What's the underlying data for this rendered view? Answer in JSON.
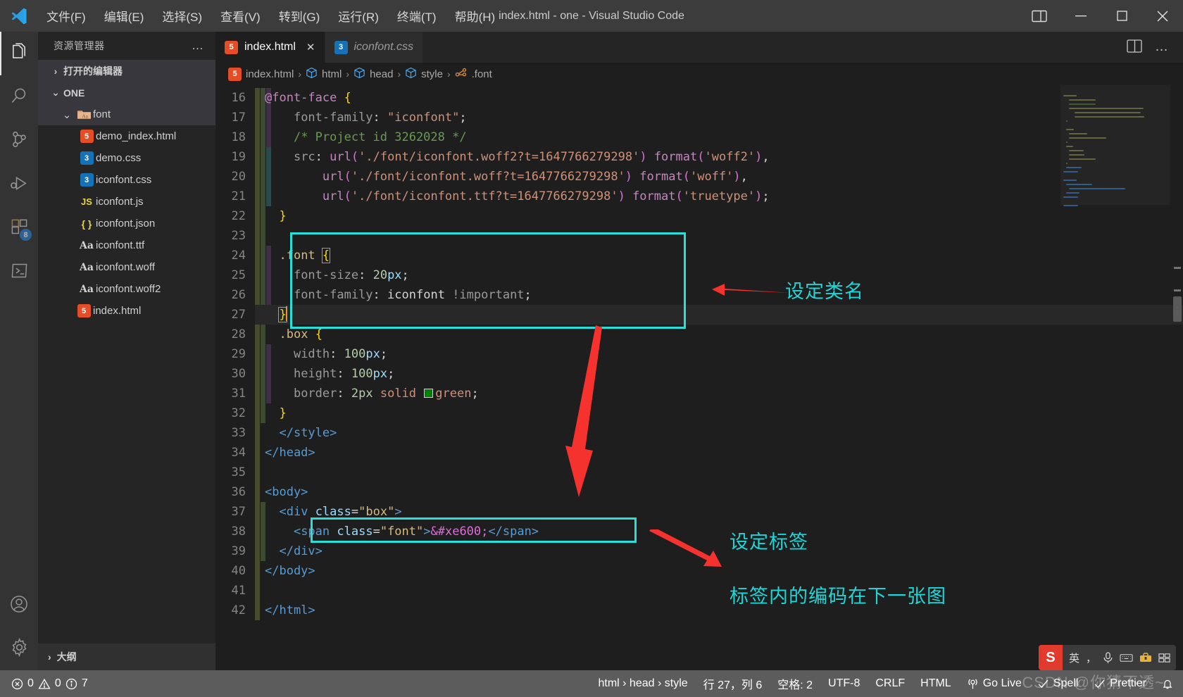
{
  "window": {
    "title": "index.html - one - Visual Studio Code",
    "logo_icon": "vscode-logo",
    "controls": {
      "layout": "⫿⫿",
      "minimize": "—",
      "maximize": "❐",
      "close": "✕"
    }
  },
  "menu": [
    {
      "label": "文件(F)"
    },
    {
      "label": "编辑(E)"
    },
    {
      "label": "选择(S)"
    },
    {
      "label": "查看(V)"
    },
    {
      "label": "转到(G)"
    },
    {
      "label": "运行(R)"
    },
    {
      "label": "终端(T)"
    },
    {
      "label": "帮助(H)"
    }
  ],
  "activitybar": [
    {
      "name": "explorer",
      "icon": "files-icon",
      "active": true,
      "badge": ""
    },
    {
      "name": "search",
      "icon": "search-icon",
      "active": false,
      "badge": ""
    },
    {
      "name": "source-control",
      "icon": "source-control-icon",
      "active": false,
      "badge": ""
    },
    {
      "name": "run-and-debug",
      "icon": "run-debug-icon",
      "active": false,
      "badge": ""
    },
    {
      "name": "extensions",
      "icon": "extensions-icon",
      "active": false,
      "badge": "8"
    },
    {
      "name": "remote",
      "icon": "terminal-remote-icon",
      "active": false,
      "badge": ""
    },
    {
      "name": "accounts",
      "icon": "account-icon",
      "active": false,
      "badge": ""
    },
    {
      "name": "settings",
      "icon": "gear-icon",
      "active": false,
      "badge": ""
    }
  ],
  "sidebar": {
    "title": "资源管理器",
    "more_label": "…",
    "open_editors_label": "打开的编辑器",
    "workspace_label": "ONE",
    "footer_label": "大纲",
    "items": [
      {
        "label": "font",
        "icon": "folder-font-icon",
        "indent": 2,
        "chevron": "⌄",
        "selected": true
      },
      {
        "label": "demo_index.html",
        "icon": "html-icon",
        "indent": 3,
        "chevron": "",
        "selected": false
      },
      {
        "label": "demo.css",
        "icon": "css-icon",
        "indent": 3,
        "chevron": "",
        "selected": false
      },
      {
        "label": "iconfont.css",
        "icon": "css-icon",
        "indent": 3,
        "chevron": "",
        "selected": false
      },
      {
        "label": "iconfont.js",
        "icon": "js-icon",
        "indent": 3,
        "chevron": "",
        "selected": false
      },
      {
        "label": "iconfont.json",
        "icon": "json-icon",
        "indent": 3,
        "chevron": "",
        "selected": false
      },
      {
        "label": "iconfont.ttf",
        "icon": "font-icon",
        "indent": 3,
        "chevron": "",
        "selected": false
      },
      {
        "label": "iconfont.woff",
        "icon": "font-icon",
        "indent": 3,
        "chevron": "",
        "selected": false
      },
      {
        "label": "iconfont.woff2",
        "icon": "font-icon",
        "indent": 3,
        "chevron": "",
        "selected": false
      },
      {
        "label": "index.html",
        "icon": "html-icon",
        "indent": 2,
        "chevron": "",
        "selected": false
      }
    ]
  },
  "tabs": [
    {
      "label": "index.html",
      "icon": "html-icon",
      "active": true,
      "italic": false,
      "close": "✕"
    },
    {
      "label": "iconfont.css",
      "icon": "css-icon",
      "active": false,
      "italic": true,
      "close": ""
    }
  ],
  "tab_actions": [
    {
      "name": "split-editor-icon",
      "glyph": "▤"
    },
    {
      "name": "more-actions-icon",
      "glyph": "…"
    }
  ],
  "breadcrumb": [
    {
      "label": "index.html",
      "icon": "html-icon"
    },
    {
      "label": "html",
      "icon": "symbol-cube-icon"
    },
    {
      "label": "head",
      "icon": "symbol-cube-icon"
    },
    {
      "label": "style",
      "icon": "symbol-cube-icon"
    },
    {
      "label": ".font",
      "icon": "symbol-ruler-icon"
    }
  ],
  "code": {
    "first_line": 16,
    "current_line": 27,
    "lines": [
      {
        "n": 16,
        "html": "<span class='t-at'>@font-face</span> <span class='t-brace'>{</span>"
      },
      {
        "n": 17,
        "html": "    <span class='t-imp'>font-family</span><span class='t-punc'>:</span> <span class='t-val'>\"iconfont\"</span><span class='t-punc'>;</span>"
      },
      {
        "n": 18,
        "html": "    <span class='t-com'>/* Project id 3262028 */</span>"
      },
      {
        "n": 19,
        "html": "    <span class='t-imp'>src</span><span class='t-punc'>:</span> <span class='t-kw'>url</span><span class='t-brace2'>(</span><span class='t-val'>'./font/iconfont.woff2?t=1647766279298'</span><span class='t-brace2'>)</span> <span class='t-kw'>format</span><span class='t-brace2'>(</span><span class='t-val'>'woff2'</span><span class='t-brace2'>)</span><span class='t-punc'>,</span>"
      },
      {
        "n": 20,
        "html": "        <span class='t-kw'>url</span><span class='t-brace2'>(</span><span class='t-val'>'./font/iconfont.woff?t=1647766279298'</span><span class='t-brace2'>)</span> <span class='t-kw'>format</span><span class='t-brace2'>(</span><span class='t-val'>'woff'</span><span class='t-brace2'>)</span><span class='t-punc'>,</span>"
      },
      {
        "n": 21,
        "html": "        <span class='t-kw'>url</span><span class='t-brace2'>(</span><span class='t-val'>'./font/iconfont.ttf?t=1647766279298'</span><span class='t-brace2'>)</span> <span class='t-kw'>format</span><span class='t-brace2'>(</span><span class='t-val'>'truetype'</span><span class='t-brace2'>)</span><span class='t-punc'>;</span>"
      },
      {
        "n": 22,
        "html": "  <span class='t-brace'>}</span>"
      },
      {
        "n": 23,
        "html": ""
      },
      {
        "n": 24,
        "html": "  <span class='t-sel'>.font</span> <span class='t-brace boxed'>{</span>"
      },
      {
        "n": 25,
        "html": "    <span class='t-imp'>font-size</span><span class='t-punc'>:</span> <span class='t-cssnum'>20</span><span class='t-gray'>px</span><span class='t-punc'>;</span>"
      },
      {
        "n": 26,
        "html": "    <span class='t-imp'>font-family</span><span class='t-punc'>:</span> <span class='t-plain'>iconfont</span> <span class='t-imp'>!important</span><span class='t-punc'>;</span>"
      },
      {
        "n": 27,
        "html": "  <span class='t-brace boxed'>}</span><span class='cursor'></span>"
      },
      {
        "n": 28,
        "html": "  <span class='t-sel'>.box</span> <span class='t-brace'>{</span>"
      },
      {
        "n": 29,
        "html": "    <span class='t-imp'>width</span><span class='t-punc'>:</span> <span class='t-cssnum'>100</span><span class='t-gray'>px</span><span class='t-punc'>;</span>"
      },
      {
        "n": 30,
        "html": "    <span class='t-imp'>height</span><span class='t-punc'>:</span> <span class='t-cssnum'>100</span><span class='t-gray'>px</span><span class='t-punc'>;</span>"
      },
      {
        "n": 31,
        "html": "    <span class='t-imp'>border</span><span class='t-punc'>:</span> <span class='t-cssnum'>2px</span> <span class='t-val'>solid</span> <span class='swatch'></span><span class='t-val'>green</span><span class='t-punc'>;</span>"
      },
      {
        "n": 32,
        "html": "  <span class='t-brace'>}</span>"
      },
      {
        "n": 33,
        "html": "  <span class='t-tag'>&lt;/style&gt;</span>"
      },
      {
        "n": 34,
        "html": "<span class='t-tag'>&lt;/head&gt;</span>"
      },
      {
        "n": 35,
        "html": ""
      },
      {
        "n": 36,
        "html": "<span class='t-tag'>&lt;body&gt;</span>"
      },
      {
        "n": 37,
        "html": "  <span class='t-tag'>&lt;div</span> <span class='t-attrname'>class</span><span class='t-plain'>=</span><span class='t-ent'>\"box\"</span><span class='t-tag'>&gt;</span>"
      },
      {
        "n": 38,
        "html": "    <span class='t-tag'>&lt;span</span> <span class='t-attrname'>class</span><span class='t-plain'>=</span><span class='t-ent'>\"font\"</span><span class='t-tag'>&gt;</span><span class='t-brace2'>&amp;#xe600;</span><span class='t-tag'>&lt;/span&gt;</span>"
      },
      {
        "n": 39,
        "html": "  <span class='t-tag'>&lt;/div&gt;</span>"
      },
      {
        "n": 40,
        "html": "<span class='t-tag'>&lt;/body&gt;</span>"
      },
      {
        "n": 41,
        "html": ""
      },
      {
        "n": 42,
        "html": "<span class='t-tag'>&lt;/html&gt;</span>"
      }
    ]
  },
  "annotations": {
    "accent_color": "#1fd6d6",
    "arrow_color": "#f5322e",
    "items": [
      {
        "name": "annotation-set-class-name",
        "text": "设定类名"
      },
      {
        "name": "annotation-set-tag",
        "text": "设定标签"
      },
      {
        "name": "annotation-code-next-image",
        "text": "标签内的编码在下一张图"
      }
    ]
  },
  "statusbar": {
    "errors": "0",
    "warnings": "0",
    "infos": "7",
    "error_icon": "error-circle-icon",
    "warning_icon": "warning-triangle-icon",
    "info_icon": "info-circle-icon",
    "breadcrumb": "html › head › style",
    "cursor_position": "行 27，列 6",
    "indentation": "空格: 2",
    "encoding": "UTF-8",
    "eol": "CRLF",
    "language": "HTML",
    "go_live": "Go Live",
    "go_live_icon": "broadcast-icon",
    "spell": "Spell",
    "spell_icon": "check-icon",
    "prettier": "Prettier",
    "prettier_icon": "check-icon",
    "bell_icon": "bell-icon"
  },
  "ime": {
    "logo": "S",
    "mode": "英",
    "items": [
      {
        "name": "ime-mode",
        "glyph": "英"
      },
      {
        "name": "ime-punctuation",
        "glyph": "，"
      },
      {
        "name": "ime-voice-icon",
        "glyph": "🎤"
      },
      {
        "name": "ime-keyboard-icon",
        "glyph": "⌨"
      },
      {
        "name": "ime-toolbox-icon",
        "glyph": "🧰"
      },
      {
        "name": "ime-menu-icon",
        "glyph": "▦"
      }
    ]
  },
  "watermark": "CSDN @你猜不透~"
}
